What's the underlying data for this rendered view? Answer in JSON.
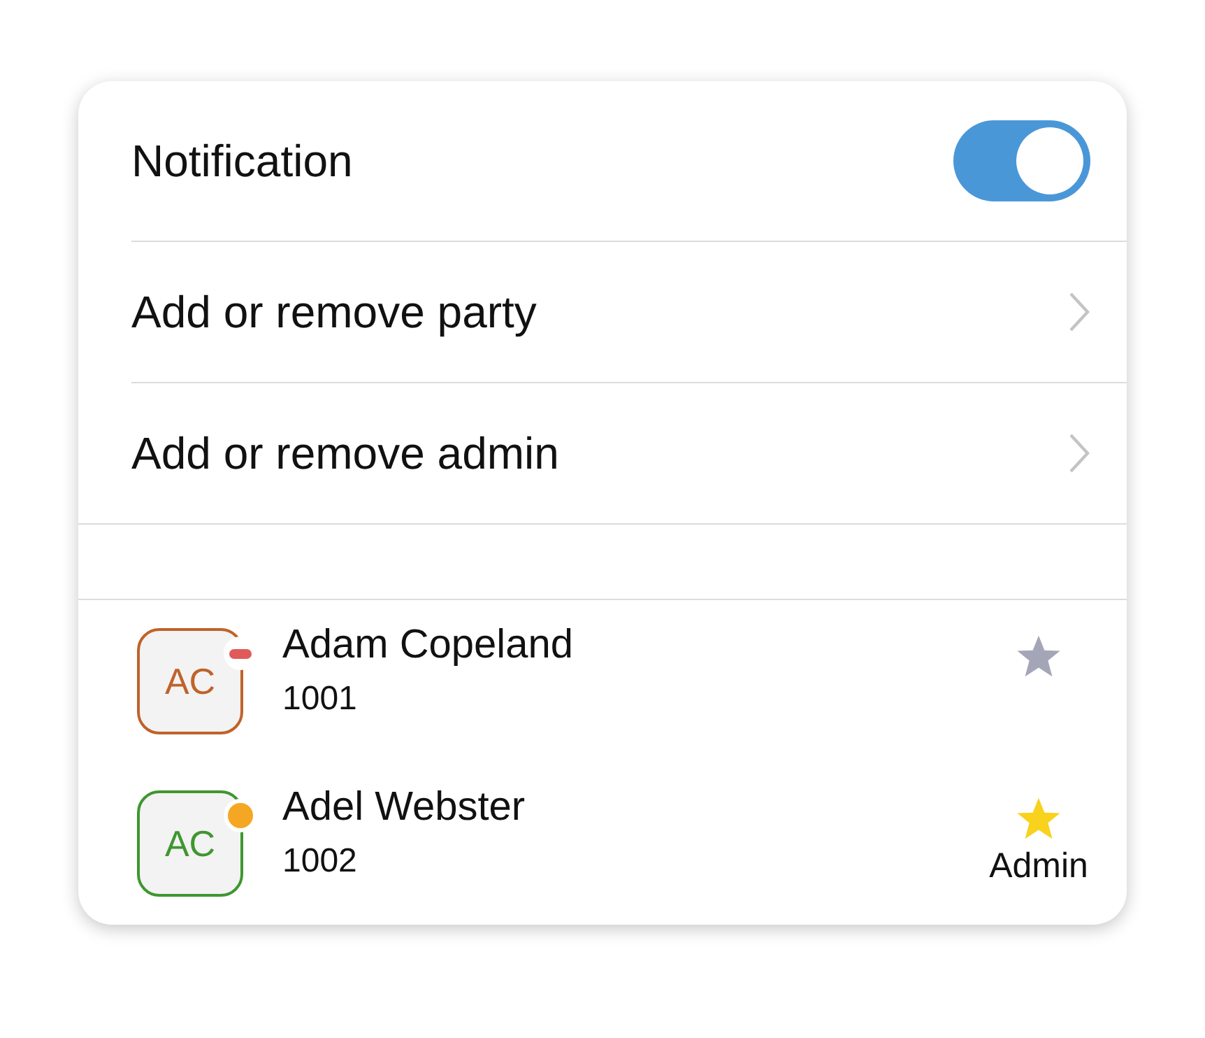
{
  "notification": {
    "label": "Notification",
    "on": true
  },
  "menu": [
    {
      "label": "Add or remove party"
    },
    {
      "label": "Add or remove admin"
    }
  ],
  "members": [
    {
      "initials": "AC",
      "name": "Adam Copeland",
      "number": "1001",
      "color": "#c0622a",
      "kind": "busy",
      "starred": false
    },
    {
      "initials": "AC",
      "name": "Adel Webster",
      "number": "1002",
      "color": "#3f9630",
      "kind": "away",
      "starred": true,
      "role": "Admin"
    }
  ]
}
